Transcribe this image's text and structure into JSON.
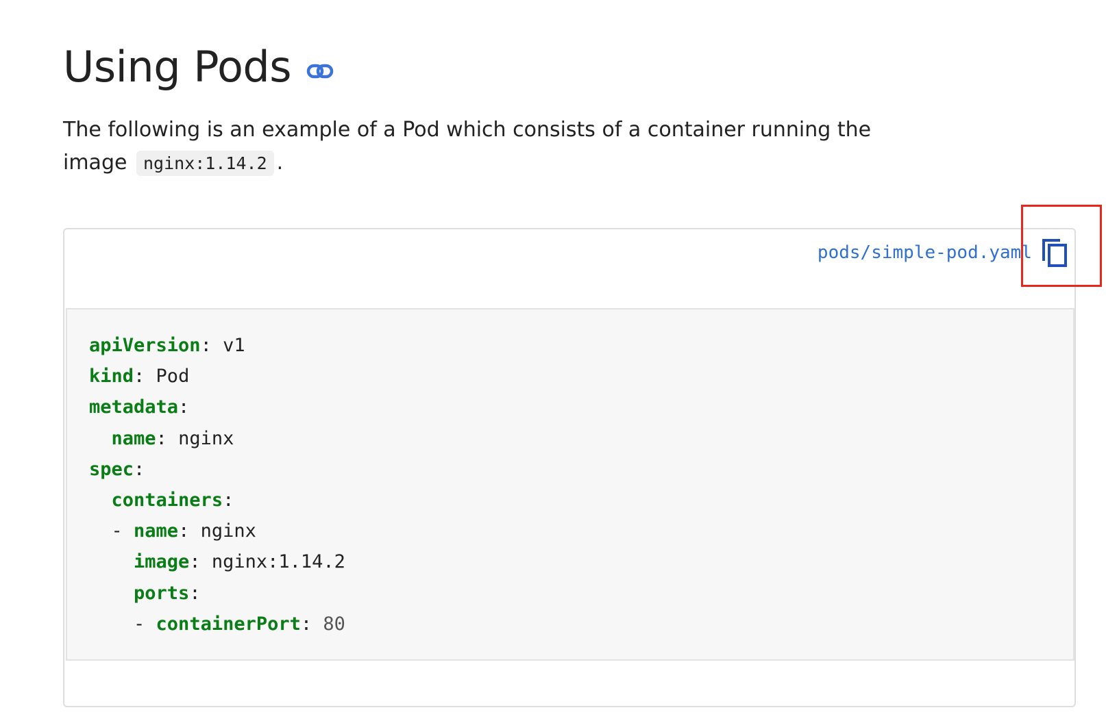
{
  "section": {
    "title": "Using Pods",
    "anchor_icon": "link-icon"
  },
  "intro": {
    "text_before": "The following is an example of a Pod which consists of a container running the image",
    "code": "nginx:1.14.2",
    "text_after": "."
  },
  "code_card": {
    "file_name": "pods/simple-pod.yaml",
    "copy_icon": "copy-icon",
    "highlight_color": "#e8261b",
    "lines": [
      {
        "indent": "",
        "prefix": "",
        "key": "apiVersion",
        "sep": ":",
        "value": " v1",
        "value_type": "str"
      },
      {
        "indent": "",
        "prefix": "",
        "key": "kind",
        "sep": ":",
        "value": " Pod",
        "value_type": "str"
      },
      {
        "indent": "",
        "prefix": "",
        "key": "metadata",
        "sep": ":",
        "value": "",
        "value_type": "str"
      },
      {
        "indent": "  ",
        "prefix": "",
        "key": "name",
        "sep": ":",
        "value": " nginx",
        "value_type": "str"
      },
      {
        "indent": "",
        "prefix": "",
        "key": "spec",
        "sep": ":",
        "value": "",
        "value_type": "str"
      },
      {
        "indent": "  ",
        "prefix": "",
        "key": "containers",
        "sep": ":",
        "value": "",
        "value_type": "str"
      },
      {
        "indent": "  ",
        "prefix": "- ",
        "key": "name",
        "sep": ":",
        "value": " nginx",
        "value_type": "str"
      },
      {
        "indent": "    ",
        "prefix": "",
        "key": "image",
        "sep": ":",
        "value": " nginx:1.14.2",
        "value_type": "str"
      },
      {
        "indent": "    ",
        "prefix": "",
        "key": "ports",
        "sep": ":",
        "value": "",
        "value_type": "str"
      },
      {
        "indent": "    ",
        "prefix": "- ",
        "key": "containerPort",
        "sep": ":",
        "value": " 80",
        "value_type": "num"
      }
    ]
  }
}
